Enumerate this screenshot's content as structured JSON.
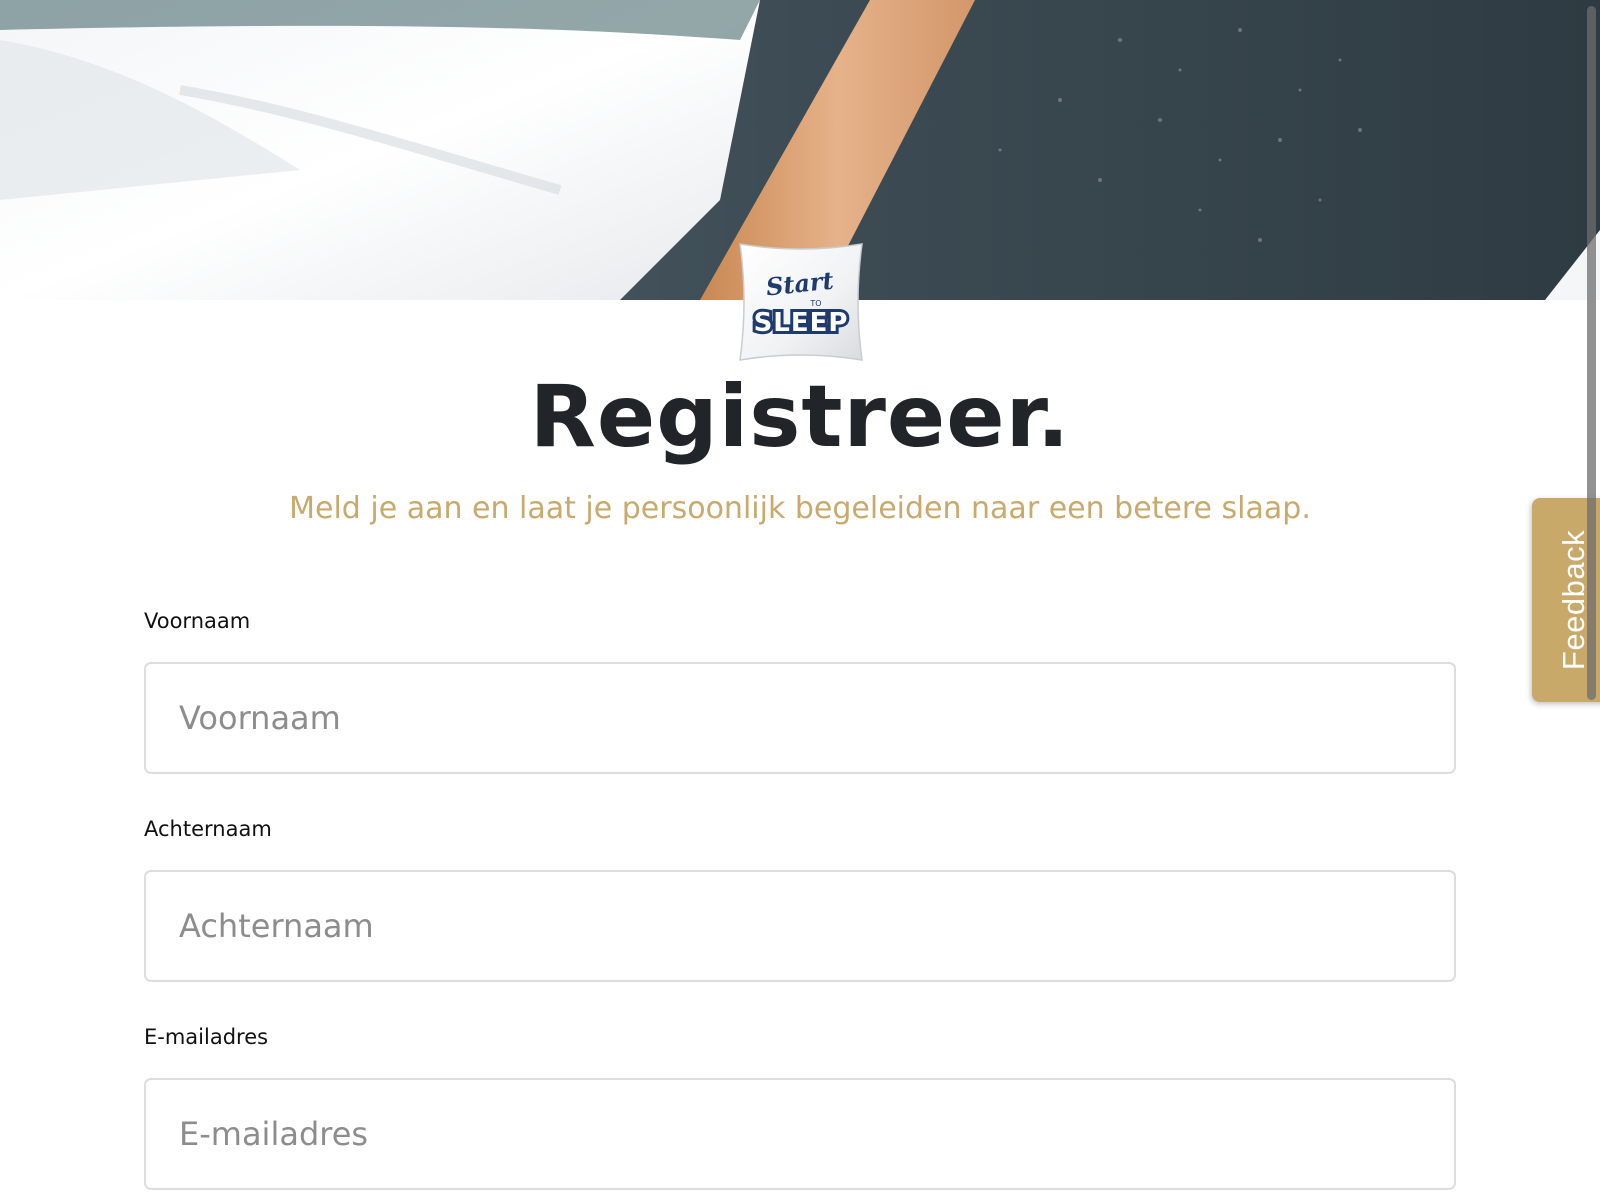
{
  "hero": {
    "image_description_icon": "sleeping-woman-photo-icon"
  },
  "logo": {
    "line1": "Start",
    "line2": "TO",
    "line3": "SLEEP"
  },
  "header": {
    "title": "Registreer.",
    "subtitle": "Meld je aan en laat je persoonlijk begeleiden naar een betere slaap."
  },
  "form": {
    "first_name": {
      "label": "Voornaam",
      "placeholder": "Voornaam",
      "value": ""
    },
    "last_name": {
      "label": "Achternaam",
      "placeholder": "Achternaam",
      "value": ""
    },
    "email": {
      "label": "E-mailadres",
      "placeholder": "E-mailadres",
      "value": ""
    }
  },
  "feedback": {
    "label": "Feedback"
  },
  "colors": {
    "accent_gold": "#c9a96c",
    "title_dark": "#212529",
    "input_border": "#dcdde0",
    "placeholder_gray": "#8d8d8d",
    "logo_navy": "#1e3a6e"
  }
}
